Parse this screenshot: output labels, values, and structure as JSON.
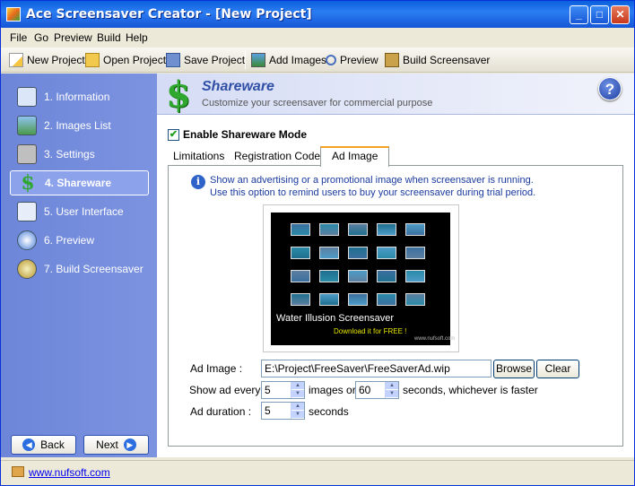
{
  "window": {
    "title": "Ace Screensaver Creator - [New Project]"
  },
  "menu": [
    "File",
    "Go",
    "Preview",
    "Build",
    "Help"
  ],
  "toolbar": {
    "new_project": "New Project",
    "open_project": "Open Project",
    "save_project": "Save Project",
    "add_images": "Add Images",
    "preview": "Preview",
    "build_screensaver": "Build Screensaver"
  },
  "sidebar": {
    "items": [
      {
        "label": "1. Information",
        "icon": "information-icon"
      },
      {
        "label": "2. Images List",
        "icon": "images-list-icon"
      },
      {
        "label": "3. Settings",
        "icon": "settings-icon"
      },
      {
        "label": "4. Shareware",
        "icon": "dollar-icon"
      },
      {
        "label": "5. User Interface",
        "icon": "user-interface-icon"
      },
      {
        "label": "6. Preview",
        "icon": "preview-icon"
      },
      {
        "label": "7. Build Screensaver",
        "icon": "build-icon"
      }
    ],
    "active_index": 3,
    "back_label": "Back",
    "next_label": "Next"
  },
  "header": {
    "title": "Shareware",
    "subtitle": "Customize your screensaver for commercial purpose",
    "help_symbol": "?"
  },
  "shareware": {
    "enable_label": "Enable Shareware Mode",
    "enabled": true
  },
  "tabs": [
    "Limitations",
    "Registration Code",
    "Ad Image"
  ],
  "active_tab": 2,
  "ad": {
    "info_line1": "Show an advertising or a promotional image when screensaver is running.",
    "info_line2": "Use this option to remind users to buy your screensaver during trial period.",
    "preview_title": "Water Illusion Screensaver",
    "preview_download": "Download it for FREE !",
    "preview_site": "www.nufsoft.com",
    "image_label": "Ad Image :",
    "image_path": "E:\\Project\\FreeSaver\\FreeSaverAd.wip",
    "browse_label": "Browse",
    "clear_label": "Clear",
    "show_every_label": "Show ad every",
    "show_every_value": "5",
    "images_or_label": "images or",
    "seconds_value": "60",
    "seconds_faster_label": "seconds, whichever is faster",
    "duration_label": "Ad duration :",
    "duration_value": "5",
    "seconds_label": "seconds"
  },
  "status": {
    "link": "www.nufsoft.com"
  }
}
